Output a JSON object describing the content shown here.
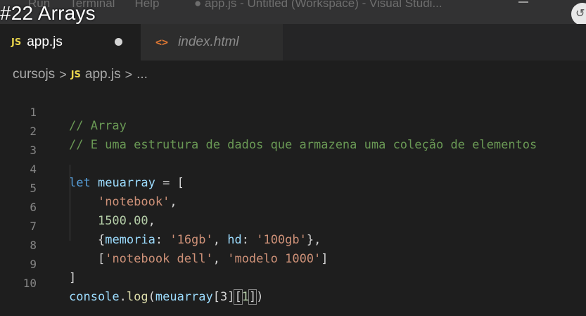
{
  "window": {
    "menu_items": [
      "Run",
      "Terminal",
      "Help"
    ],
    "title": "● app.js - Untitled (Workspace) - Visual Studi..."
  },
  "overlay": {
    "video_title": "#22 Arrays",
    "badge_glyph": "↺"
  },
  "tabs": [
    {
      "icon": "JS",
      "label": "app.js",
      "dirty": true
    },
    {
      "icon": "<>",
      "label": "index.html",
      "dirty": false
    }
  ],
  "breadcrumb": {
    "root": "cursojs",
    "sep": ">",
    "file_icon": "JS",
    "file": "app.js",
    "more": "..."
  },
  "editor": {
    "line_numbers": [
      "1",
      "2",
      "3",
      "4",
      "5",
      "6",
      "7",
      "8",
      "9",
      "10"
    ],
    "lines": {
      "l1": {
        "comment": "// Array"
      },
      "l2": {
        "comment": "// E uma estrutura de dados que armazena uma coleção de elementos"
      },
      "l4": {
        "kw": "let",
        "var": "meuarray",
        "op": " = ["
      },
      "l5": {
        "str": "'notebook'",
        "tail": ","
      },
      "l6": {
        "num": "1500.00",
        "tail": ","
      },
      "l7": {
        "open": "{",
        "k1": "memoria",
        "c1": ": ",
        "v1": "'16gb'",
        "sep": ", ",
        "k2": "hd",
        "c2": ": ",
        "v2": "'100gb'",
        "close": "},"
      },
      "l8": {
        "open": "[",
        "s1": "'notebook dell'",
        "sep": ", ",
        "s2": "'modelo 1000'",
        "close": "]"
      },
      "l9": {
        "close": "]"
      },
      "l10": {
        "obj": "console",
        "dot": ".",
        "fn": "log",
        "p1": "(",
        "var": "meuarray",
        "idx1": "[3]",
        "b_open": "[",
        "idx_num": "1",
        "b_close": "]",
        "p2": ")"
      }
    }
  }
}
